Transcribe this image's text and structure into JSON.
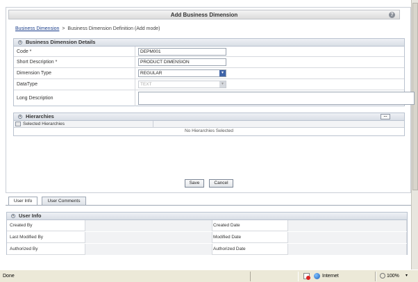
{
  "page": {
    "title": "Add Business Dimension",
    "help_label": "?"
  },
  "breadcrumb": {
    "link": "Business Dimension",
    "separator": ">",
    "current": "Business Dimension Definition (Add mode)"
  },
  "details": {
    "section_title": "Business Dimension Details",
    "fields": {
      "code_label": "Code *",
      "code_value": "DEPM001",
      "short_desc_label": "Short Description *",
      "short_desc_value": "PRODUCT DIMENSION",
      "dim_type_label": "Dimension Type",
      "dim_type_value": "REGULAR",
      "datatype_label": "DataType",
      "datatype_value": "TEXT",
      "long_desc_label": "Long Description",
      "long_desc_value": ""
    }
  },
  "hierarchies": {
    "section_title": "Hierarchies",
    "add_button": "...",
    "column_header": "Selected Hierarchies",
    "empty_text": "No Hierarchies Selected"
  },
  "actions": {
    "save": "Save",
    "cancel": "Cancel"
  },
  "tabs": {
    "user_info": "User Info",
    "user_comments": "User Comments"
  },
  "user_info": {
    "section_title": "User Info",
    "created_by": "Created By",
    "created_date": "Created Date",
    "last_modified_by": "Last Modified By",
    "modified_date": "Modified Date",
    "authorized_by": "Authorized By",
    "authorized_date": "Authorized Date"
  },
  "statusbar": {
    "status": "Done",
    "zone": "Internet",
    "zoom": "100%",
    "zoom_caret": "▾"
  },
  "icons": {
    "collapse": "«",
    "dropdown": "▾"
  }
}
